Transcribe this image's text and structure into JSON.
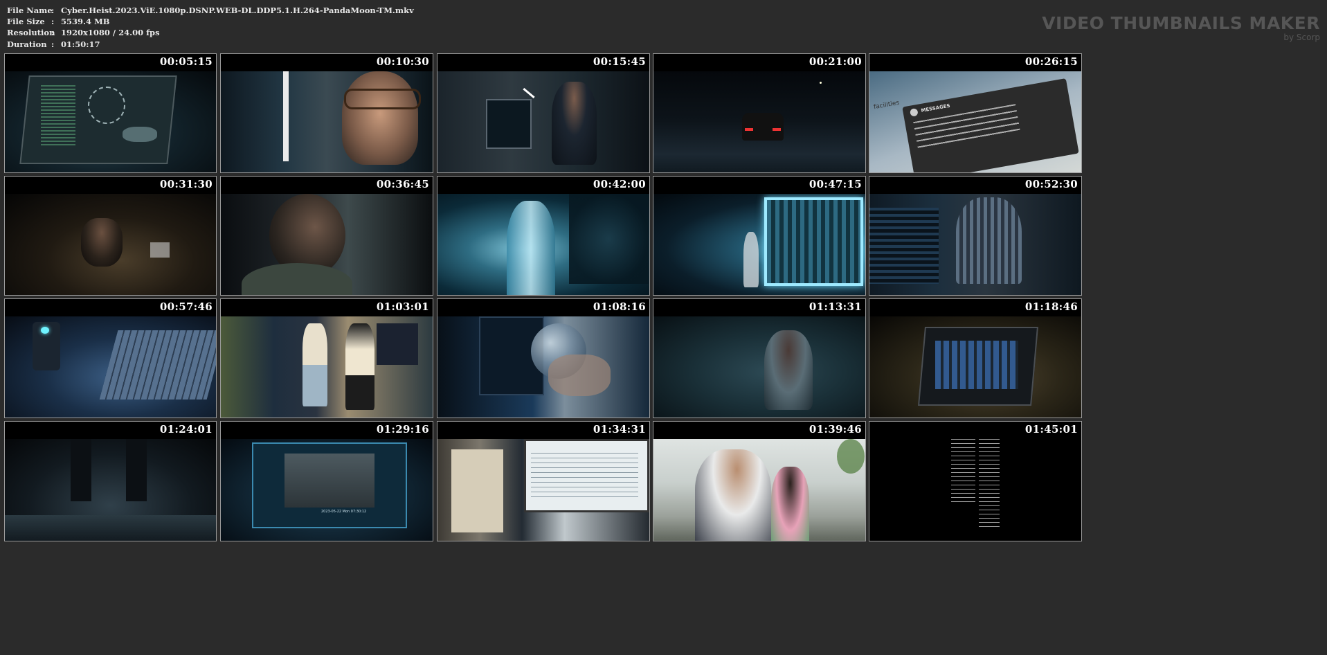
{
  "file_info": [
    {
      "label": "File Name",
      "sep": ":",
      "value": "Cyber.Heist.2023.ViE.1080p.DSNP.WEB-DL.DDP5.1.H.264-PandaMoon-TM.mkv"
    },
    {
      "label": "File Size",
      "sep": ":",
      "value": "5539.4 MB"
    },
    {
      "label": "Resolution",
      "sep": ":",
      "value": "1920x1080 / 24.00 fps"
    },
    {
      "label": "Duration",
      "sep": ":",
      "value": "01:50:17"
    }
  ],
  "brand": {
    "title": "VIDEO THUMBNAILS MAKER",
    "subtitle": "by Scorp"
  },
  "thumbnails": [
    {
      "timestamp": "00:05:15"
    },
    {
      "timestamp": "00:10:30"
    },
    {
      "timestamp": "00:15:45"
    },
    {
      "timestamp": "00:21:00"
    },
    {
      "timestamp": "00:26:15"
    },
    {
      "timestamp": "00:31:30"
    },
    {
      "timestamp": "00:36:45"
    },
    {
      "timestamp": "00:42:00"
    },
    {
      "timestamp": "00:47:15"
    },
    {
      "timestamp": "00:52:30"
    },
    {
      "timestamp": "00:57:46"
    },
    {
      "timestamp": "01:03:01"
    },
    {
      "timestamp": "01:08:16"
    },
    {
      "timestamp": "01:13:31"
    },
    {
      "timestamp": "01:18:46"
    },
    {
      "timestamp": "01:24:01"
    },
    {
      "timestamp": "01:29:16"
    },
    {
      "timestamp": "01:34:31"
    },
    {
      "timestamp": "01:39:46"
    },
    {
      "timestamp": "01:45:01"
    }
  ],
  "frame_5": {
    "message_header": "MESSAGES",
    "side_text": "facilities"
  },
  "frame_17": {
    "camera_time": "2023-05-22 Mon 07:30:12"
  }
}
